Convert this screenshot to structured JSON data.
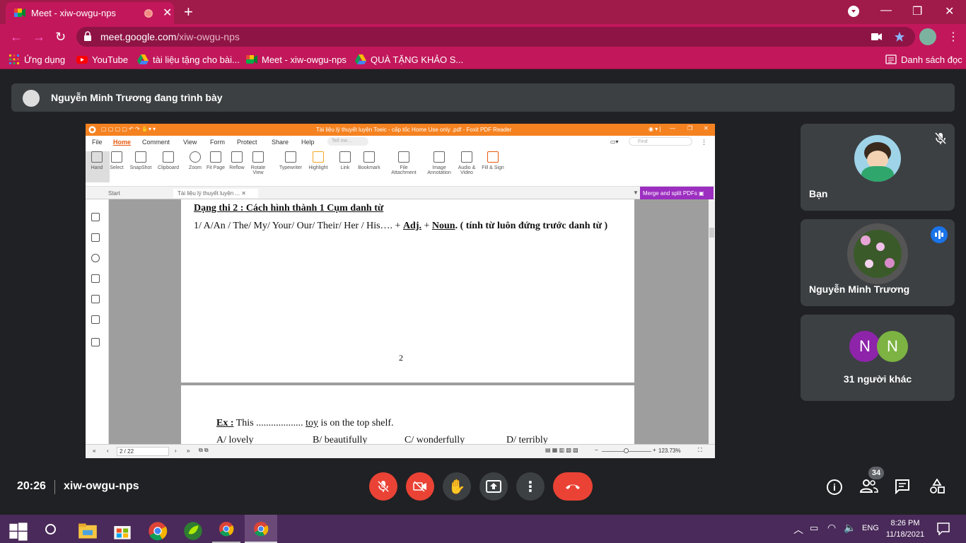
{
  "browser": {
    "tab_title": "Meet - xiw-owgu-nps",
    "url_host": "meet.google.com",
    "url_path": "/xiw-owgu-nps",
    "bookmarks": [
      {
        "label": "Ứng dụng",
        "icon": "apps-grid-icon"
      },
      {
        "label": "YouTube",
        "icon": "youtube-icon"
      },
      {
        "label": "tài liệu tặng cho bài...",
        "icon": "drive-icon"
      },
      {
        "label": "Meet - xiw-owgu-nps",
        "icon": "meet-icon"
      },
      {
        "label": "QUÀ TẶNG KHẢO S...",
        "icon": "drive-icon"
      }
    ],
    "reading_list": "Danh sách đọc"
  },
  "meet": {
    "presenter_text": "Nguyễn Minh Trương đang trình bày",
    "time": "20:26",
    "meeting_code": "xiw-owgu-nps",
    "participants_badge": "34",
    "tiles": [
      {
        "name": "Bạn",
        "muted": true
      },
      {
        "name": "Nguyễn Minh Trương",
        "speaking": true
      },
      {
        "name": "31 người khác",
        "avatars": [
          "N",
          "N"
        ]
      }
    ],
    "colors": {
      "end_call": "#ea4335",
      "accent": "#1a73e8",
      "avatar1": "#8e24aa",
      "avatar2": "#7cb342"
    }
  },
  "foxit": {
    "title": "Tài liệu lý thuyết luyện Toeic - cấp tốc Home Use only .pdf - Foxit PDF Reader",
    "menu": [
      "File",
      "Home",
      "Comment",
      "View",
      "Form",
      "Protect",
      "Share",
      "Help"
    ],
    "tell_me": "Tell me...",
    "find": "Find",
    "ribbon": [
      "Hand",
      "Select",
      "SnapShot",
      "Clipboard",
      "Zoom",
      "Fit Page",
      "Reflow",
      "Rotate View",
      "Typewriter",
      "Highlight",
      "Link",
      "Bookmark",
      "File Attachment",
      "Image Annotation",
      "Audio & Video",
      "Fill & Sign"
    ],
    "doc_tabs": [
      "Start",
      "Tài liệu lý thuyết luyện ..."
    ],
    "merge": "Merge and split PDFs",
    "page1": {
      "heading": "Dạng thi 2 : Cách hình thành 1 Cụm danh từ",
      "rule_start": "1/ A/An / The/ My/ Your/ Our/ Their/ Her / His…. + ",
      "adj": "Adj.",
      "plus": " + ",
      "noun": "Noun",
      "rule_end": ". ( tính từ luôn đứng trước danh từ )",
      "page_number": "2"
    },
    "page2": {
      "ex_label": "Ex :",
      "ex_before": " This ................... ",
      "ex_toy": "toy",
      "ex_after": " is on the top shelf.",
      "options": [
        "A/ lovely",
        "B/ beautifully",
        "C/ wonderfully",
        "D/ terribly"
      ]
    },
    "status": {
      "page": "2 / 22",
      "zoom": "123.73%"
    }
  },
  "taskbar": {
    "lang": "ENG",
    "time": "8:26 PM",
    "date": "11/18/2021"
  }
}
